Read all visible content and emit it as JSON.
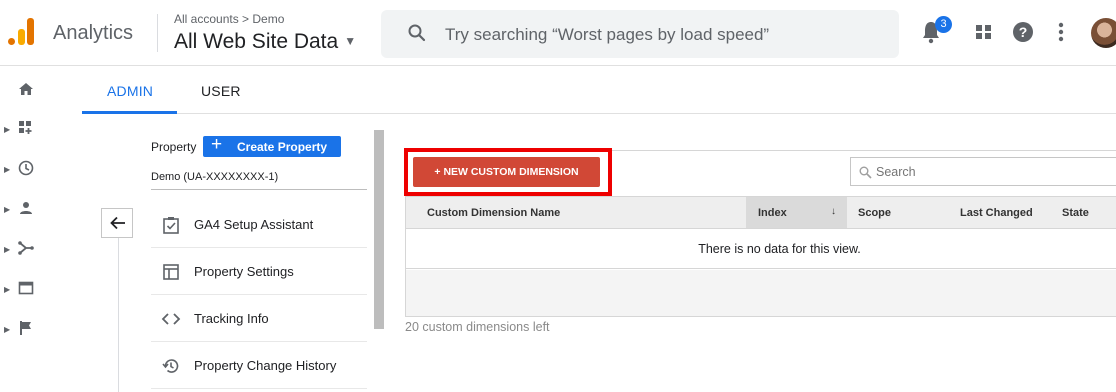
{
  "header": {
    "app_name": "Analytics",
    "breadcrumb": "All accounts > Demo",
    "view_selector": "All Web Site Data",
    "search_placeholder": "Try searching “Worst pages by load speed”",
    "notification_count": "3",
    "help_label": "?"
  },
  "rail": {
    "items": [
      "home-icon",
      "customization-icon",
      "realtime-icon",
      "audience-icon",
      "acquisition-icon",
      "behavior-icon",
      "conversions-icon"
    ]
  },
  "tabs": [
    {
      "label": "ADMIN",
      "active": true
    },
    {
      "label": "USER",
      "active": false
    }
  ],
  "property": {
    "label": "Property",
    "create_label": "Create Property",
    "selected": "Demo (UA-XXXXXXXX-1)",
    "menu": [
      {
        "label": "GA4 Setup Assistant",
        "icon": "checkbox-icon"
      },
      {
        "label": "Property Settings",
        "icon": "layout-icon"
      },
      {
        "label": "Tracking Info",
        "icon": "code-icon"
      },
      {
        "label": "Property Change History",
        "icon": "history-icon"
      }
    ]
  },
  "custom_dimensions": {
    "new_button": "+ NEW CUSTOM DIMENSION",
    "search_placeholder": "Search",
    "columns": [
      "Custom Dimension Name",
      "Index",
      "Scope",
      "Last Changed",
      "State"
    ],
    "sorted_column": "Index",
    "empty_message": "There is no data for this view.",
    "remaining": "20 custom dimensions left"
  },
  "colors": {
    "accent": "#1a73e8",
    "danger_button": "#d14836",
    "highlight": "#ee0000"
  }
}
